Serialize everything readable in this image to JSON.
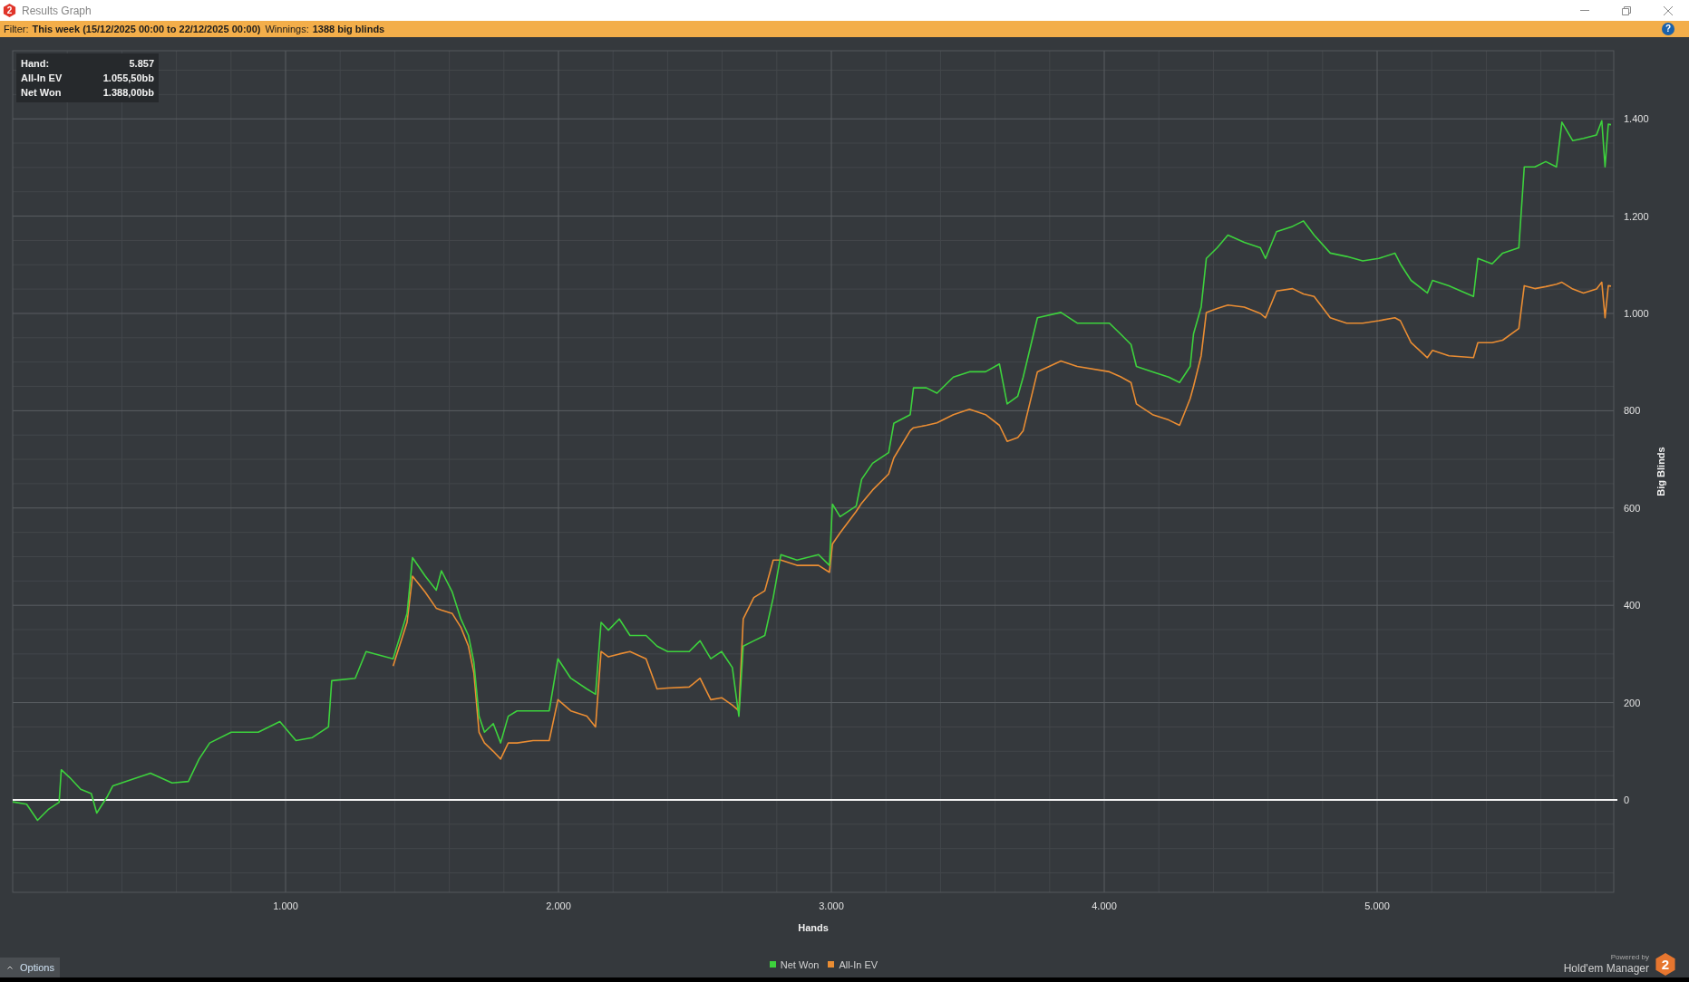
{
  "window": {
    "logo_mark": "2",
    "title": "Results Graph"
  },
  "filter_bar": {
    "items": [
      {
        "label": "Filter:",
        "value": "This week (15/12/2025 00:00 to 22/12/2025 00:00)"
      },
      {
        "label": "Winnings:",
        "value": "1388 big blinds"
      }
    ],
    "help_button": "?"
  },
  "chart": {
    "tooltip": [
      {
        "label": "Hand:",
        "value": "5.857"
      },
      {
        "label": "All-In EV",
        "value": "1.055,50bb"
      },
      {
        "label": "Net Won",
        "value": "1.388,00bb"
      }
    ],
    "chart_data": {
      "type": "line",
      "grid": true,
      "xlabel": "Hands",
      "ylabel": "Big Blinds",
      "xlim": [
        0,
        5867
      ],
      "ylim": [
        -190,
        1540
      ],
      "xticks": [
        {
          "value": 1000,
          "label": "1.000"
        },
        {
          "value": 2000,
          "label": "2.000"
        },
        {
          "value": 3000,
          "label": "3.000"
        },
        {
          "value": 4000,
          "label": "4.000"
        },
        {
          "value": 5000,
          "label": "5.000"
        }
      ],
      "yticks": [
        {
          "value": 0,
          "label": "0"
        },
        {
          "value": 200,
          "label": "200"
        },
        {
          "value": 400,
          "label": "400"
        },
        {
          "value": 600,
          "label": "600"
        },
        {
          "value": 800,
          "label": "800"
        },
        {
          "value": 1000,
          "label": "1.000"
        },
        {
          "value": 1200,
          "label": "1.200"
        },
        {
          "value": 1400,
          "label": "1.400"
        }
      ],
      "x": [
        0,
        51,
        91,
        130,
        170,
        178,
        209,
        249,
        288,
        308,
        347,
        367,
        426,
        505,
        584,
        644,
        683,
        722,
        801,
        900,
        979,
        1038,
        1098,
        1157,
        1169,
        1255,
        1295,
        1394,
        1445,
        1465,
        1512,
        1552,
        1571,
        1611,
        1642,
        1670,
        1690,
        1709,
        1729,
        1761,
        1788,
        1816,
        1848,
        1907,
        1966,
        1998,
        2045,
        2104,
        2136,
        2156,
        2183,
        2223,
        2262,
        2321,
        2361,
        2400,
        2479,
        2519,
        2558,
        2598,
        2637,
        2661,
        2677,
        2716,
        2756,
        2787,
        2815,
        2874,
        2953,
        2993,
        3004,
        3032,
        3091,
        3111,
        3151,
        3210,
        3229,
        3289,
        3301,
        3348,
        3387,
        3447,
        3506,
        3565,
        3616,
        3644,
        3683,
        3703,
        3755,
        3841,
        3901,
        4019,
        4059,
        4098,
        4118,
        4177,
        4236,
        4276,
        4315,
        4327,
        4355,
        4374,
        4414,
        4453,
        4513,
        4572,
        4591,
        4631,
        4690,
        4730,
        4769,
        4828,
        4888,
        4947,
        5006,
        5065,
        5085,
        5124,
        5184,
        5203,
        5263,
        5353,
        5369,
        5421,
        5460,
        5519,
        5539,
        5578,
        5618,
        5657,
        5677,
        5717,
        5756,
        5804,
        5823,
        5835,
        5847,
        5857
      ],
      "series": [
        {
          "name": "Net Won",
          "color": "#3dd23d",
          "values": [
            -4,
            -9,
            -42,
            -20,
            -5,
            62,
            46,
            22,
            13,
            -27,
            7,
            29,
            40,
            55,
            35,
            38,
            84,
            117,
            139,
            139,
            161,
            122,
            128,
            150,
            245,
            250,
            305,
            290,
            383,
            498,
            460,
            431,
            471,
            427,
            372,
            338,
            283,
            172,
            139,
            157,
            117,
            172,
            183,
            183,
            183,
            290,
            250,
            228,
            217,
            365,
            349,
            372,
            338,
            338,
            316,
            305,
            305,
            327,
            290,
            305,
            272,
            172,
            316,
            327,
            338,
            416,
            504,
            493,
            504,
            482,
            608,
            582,
            604,
            659,
            692,
            714,
            774,
            792,
            847,
            847,
            836,
            869,
            880,
            880,
            896,
            814,
            830,
            869,
            991,
            1002,
            980,
            980,
            958,
            936,
            891,
            880,
            869,
            858,
            891,
            958,
            1013,
            1113,
            1135,
            1161,
            1146,
            1135,
            1113,
            1168,
            1179,
            1190,
            1161,
            1124,
            1117,
            1108,
            1113,
            1124,
            1102,
            1068,
            1042,
            1068,
            1057,
            1035,
            1113,
            1102,
            1124,
            1135,
            1301,
            1301,
            1312,
            1301,
            1393,
            1355,
            1360,
            1367,
            1396,
            1301,
            1389,
            1388
          ]
        },
        {
          "name": "All-In EV",
          "color": "#ea8d33",
          "values": [
            null,
            null,
            null,
            null,
            null,
            null,
            null,
            null,
            null,
            null,
            null,
            null,
            null,
            null,
            null,
            null,
            null,
            null,
            null,
            null,
            null,
            null,
            null,
            null,
            null,
            null,
            null,
            275,
            365,
            460,
            427,
            394,
            390,
            383,
            355,
            316,
            261,
            139,
            117,
            100,
            84,
            117,
            117,
            122,
            122,
            206,
            183,
            172,
            150,
            305,
            294,
            300,
            305,
            290,
            228,
            230,
            232,
            250,
            206,
            210,
            195,
            183,
            372,
            416,
            430,
            493,
            493,
            482,
            482,
            468,
            526,
            549,
            593,
            610,
            637,
            670,
            703,
            759,
            765,
            770,
            775,
            792,
            803,
            792,
            770,
            737,
            745,
            759,
            880,
            902,
            891,
            880,
            870,
            858,
            814,
            792,
            781,
            770,
            825,
            850,
            913,
            1002,
            1010,
            1017,
            1013,
            1000,
            991,
            1046,
            1051,
            1040,
            1035,
            991,
            980,
            980,
            985,
            991,
            985,
            940,
            909,
            924,
            913,
            909,
            940,
            940,
            945,
            969,
            1057,
            1051,
            1055,
            1060,
            1064,
            1050,
            1042,
            1050,
            1064,
            991,
            1057,
            1056
          ]
        }
      ]
    }
  },
  "bottom_bar": {
    "options_button": "Options",
    "powered_by": "Powered by",
    "brand": "Hold'em Manager",
    "brand_logo_mark": "2"
  }
}
